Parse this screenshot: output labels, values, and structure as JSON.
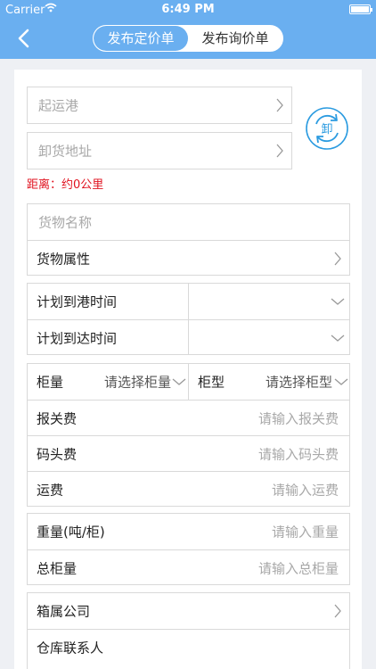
{
  "status_bar": {
    "carrier": "Carrier",
    "time": "6:49 PM"
  },
  "nav": {
    "tabs": [
      {
        "label": "发布定价单",
        "active": true
      },
      {
        "label": "发布询价单",
        "active": false
      }
    ]
  },
  "form": {
    "origin_port_placeholder": "起运港",
    "unload_address_placeholder": "卸货地址",
    "swap_label": "卸",
    "distance_text": "距离：约0公里",
    "cargo_name_placeholder": "货物名称",
    "cargo_attr_label": "货物属性",
    "port_time_label": "计划到港时间",
    "arrive_time_label": "计划到达时间",
    "container_qty_label": "柜量",
    "container_qty_placeholder": "请选择柜量",
    "container_type_label": "柜型",
    "container_type_placeholder": "请选择柜型",
    "customs_fee_label": "报关费",
    "customs_fee_placeholder": "请输入报关费",
    "terminal_fee_label": "码头费",
    "terminal_fee_placeholder": "请输入码头费",
    "freight_label": "运费",
    "freight_placeholder": "请输入运费",
    "weight_label": "重量(吨/柜)",
    "weight_placeholder": "请输入重量",
    "total_containers_label": "总柜量",
    "total_containers_placeholder": "请输入总柜量",
    "box_company_label": "箱属公司",
    "warehouse_contact_label": "仓库联系人"
  },
  "colors": {
    "header": "#6aaff0",
    "accent": "#2b9be0",
    "warning": "#e0121f"
  }
}
